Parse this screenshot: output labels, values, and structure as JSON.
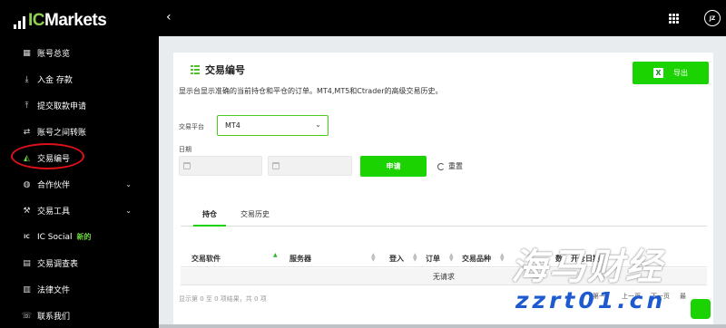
{
  "brand": {
    "logo_text": "ICMarkets",
    "logo_accent": "IC",
    "logo_rest": "Markets",
    "accent_color": "#1ad300"
  },
  "sidebar": {
    "items": [
      {
        "label": "账号总览",
        "icon": "dashboard-icon"
      },
      {
        "label": "入金 存款",
        "icon": "deposit-icon"
      },
      {
        "label": "提交取款申请",
        "icon": "withdraw-icon"
      },
      {
        "label": "账号之间转账",
        "icon": "transfer-icon"
      },
      {
        "label": "交易编号",
        "icon": "chart-icon",
        "active": true
      },
      {
        "label": "合作伙伴",
        "icon": "partner-icon",
        "expandable": true
      },
      {
        "label": "交易工具",
        "icon": "tools-icon",
        "expandable": true
      },
      {
        "label": "IC Social",
        "icon": "ic-social-icon",
        "badge": "新的"
      },
      {
        "label": "交易调查表",
        "icon": "survey-icon"
      },
      {
        "label": "法律文件",
        "icon": "legal-icon"
      },
      {
        "label": "联系我们",
        "icon": "contact-icon"
      }
    ]
  },
  "topbar": {
    "back_icon": "‹",
    "avatar_initials": "JZ"
  },
  "page": {
    "title": "交易编号",
    "export_label": "导出",
    "export_icon_letter": "X",
    "description": "显示台显示准确的当前持仓和平仓的订单。MT4,MT5和Ctrader的高级交易历史。",
    "platform_label": "交易平台",
    "platform_value": "MT4",
    "date_label": "日期",
    "submit_label": "申请",
    "reset_label": "重置",
    "tabs": [
      "持仓",
      "交易历史"
    ],
    "table": {
      "columns": [
        "交易软件",
        "服务器",
        "登入",
        "订单",
        "交易品种",
        "数",
        "开仓日期"
      ],
      "empty_text": "无请求"
    },
    "footer_info": "显示第 0 至 0 项结果，共 0 项",
    "pager": {
      "first": "第一",
      "prev": "上一页",
      "next": "下一页",
      "last": "最"
    }
  },
  "watermark": {
    "cn": "海马财经",
    "url": "zzrt01.cn"
  }
}
